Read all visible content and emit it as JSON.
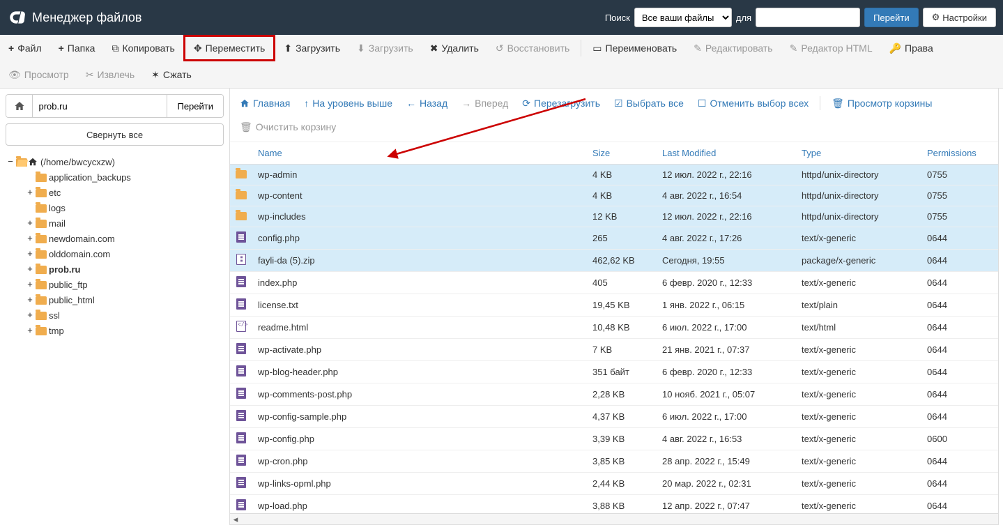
{
  "header": {
    "title": "Менеджер файлов",
    "search_label": "Поиск",
    "search_for": "для",
    "search_select": "Все ваши файлы",
    "go_button": "Перейти",
    "settings_button": "Настройки"
  },
  "toolbar": {
    "file": "Файл",
    "folder": "Папка",
    "copy": "Копировать",
    "move": "Переместить",
    "upload": "Загрузить",
    "download": "Загрузить",
    "delete": "Удалить",
    "restore": "Восстановить",
    "rename": "Переименовать",
    "edit": "Редактировать",
    "html_editor": "Редактор HTML",
    "permissions": "Права",
    "view": "Просмотр",
    "extract": "Извлечь",
    "compress": "Сжать"
  },
  "sidebar": {
    "path_value": "prob.ru",
    "go": "Перейти",
    "collapse_all": "Свернуть все",
    "root_label": "(/home/bwcycxzw)",
    "children": [
      {
        "label": "application_backups",
        "expandable": false
      },
      {
        "label": "etc",
        "expandable": true
      },
      {
        "label": "logs",
        "expandable": false
      },
      {
        "label": "mail",
        "expandable": true
      },
      {
        "label": "newdomain.com",
        "expandable": true
      },
      {
        "label": "olddomain.com",
        "expandable": true
      },
      {
        "label": "prob.ru",
        "expandable": true,
        "bold": true
      },
      {
        "label": "public_ftp",
        "expandable": true
      },
      {
        "label": "public_html",
        "expandable": true
      },
      {
        "label": "ssl",
        "expandable": true
      },
      {
        "label": "tmp",
        "expandable": true
      }
    ]
  },
  "file_toolbar": {
    "home": "Главная",
    "up_one": "На уровень выше",
    "back": "Назад",
    "forward": "Вперед",
    "reload": "Перезагрузить",
    "select_all": "Выбрать все",
    "unselect_all": "Отменить выбор всех",
    "view_trash": "Просмотр корзины",
    "empty_trash": "Очистить корзину"
  },
  "columns": {
    "name": "Name",
    "size": "Size",
    "modified": "Last Modified",
    "type": "Type",
    "perms": "Permissions"
  },
  "files": [
    {
      "icon": "folder",
      "name": "wp-admin",
      "size": "4 KB",
      "modified": "12 июл. 2022 г., 22:16",
      "type": "httpd/unix-directory",
      "perms": "0755",
      "selected": true
    },
    {
      "icon": "folder",
      "name": "wp-content",
      "size": "4 KB",
      "modified": "4 авг. 2022 г., 16:54",
      "type": "httpd/unix-directory",
      "perms": "0755",
      "selected": true
    },
    {
      "icon": "folder",
      "name": "wp-includes",
      "size": "12 KB",
      "modified": "12 июл. 2022 г., 22:16",
      "type": "httpd/unix-directory",
      "perms": "0755",
      "selected": true
    },
    {
      "icon": "file",
      "name": "config.php",
      "size": "265",
      "modified": "4 авг. 2022 г., 17:26",
      "type": "text/x-generic",
      "perms": "0644",
      "selected": true
    },
    {
      "icon": "zip",
      "name": "fayli-da (5).zip",
      "size": "462,62 KB",
      "modified": "Сегодня, 19:55",
      "type": "package/x-generic",
      "perms": "0644",
      "selected": true
    },
    {
      "icon": "file",
      "name": "index.php",
      "size": "405",
      "modified": "6 февр. 2020 г., 12:33",
      "type": "text/x-generic",
      "perms": "0644",
      "selected": false
    },
    {
      "icon": "file",
      "name": "license.txt",
      "size": "19,45 KB",
      "modified": "1 янв. 2022 г., 06:15",
      "type": "text/plain",
      "perms": "0644",
      "selected": false
    },
    {
      "icon": "html",
      "name": "readme.html",
      "size": "10,48 KB",
      "modified": "6 июл. 2022 г., 17:00",
      "type": "text/html",
      "perms": "0644",
      "selected": false
    },
    {
      "icon": "file",
      "name": "wp-activate.php",
      "size": "7 KB",
      "modified": "21 янв. 2021 г., 07:37",
      "type": "text/x-generic",
      "perms": "0644",
      "selected": false
    },
    {
      "icon": "file",
      "name": "wp-blog-header.php",
      "size": "351 байт",
      "modified": "6 февр. 2020 г., 12:33",
      "type": "text/x-generic",
      "perms": "0644",
      "selected": false
    },
    {
      "icon": "file",
      "name": "wp-comments-post.php",
      "size": "2,28 KB",
      "modified": "10 нояб. 2021 г., 05:07",
      "type": "text/x-generic",
      "perms": "0644",
      "selected": false
    },
    {
      "icon": "file",
      "name": "wp-config-sample.php",
      "size": "4,37 KB",
      "modified": "6 июл. 2022 г., 17:00",
      "type": "text/x-generic",
      "perms": "0644",
      "selected": false
    },
    {
      "icon": "file",
      "name": "wp-config.php",
      "size": "3,39 KB",
      "modified": "4 авг. 2022 г., 16:53",
      "type": "text/x-generic",
      "perms": "0600",
      "selected": false
    },
    {
      "icon": "file",
      "name": "wp-cron.php",
      "size": "3,85 KB",
      "modified": "28 апр. 2022 г., 15:49",
      "type": "text/x-generic",
      "perms": "0644",
      "selected": false
    },
    {
      "icon": "file",
      "name": "wp-links-opml.php",
      "size": "2,44 KB",
      "modified": "20 мар. 2022 г., 02:31",
      "type": "text/x-generic",
      "perms": "0644",
      "selected": false
    },
    {
      "icon": "file",
      "name": "wp-load.php",
      "size": "3,88 KB",
      "modified": "12 апр. 2022 г., 07:47",
      "type": "text/x-generic",
      "perms": "0644",
      "selected": false
    }
  ]
}
